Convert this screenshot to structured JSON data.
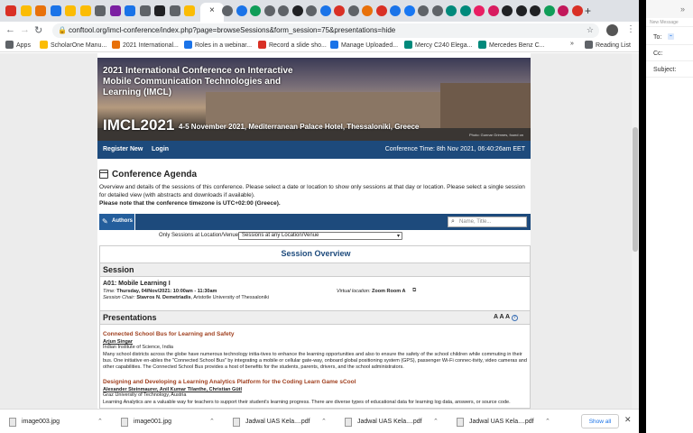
{
  "browser": {
    "url": "conftool.org/imcl-conference/index.php?page=browseSessions&form_session=75&presentations=hide",
    "tab_colors": [
      "#d93025",
      "#fbbc04",
      "#e8710a",
      "#1a73e8",
      "#fbbc04",
      "#fbbc04",
      "#5f6368",
      "#7b1fa2",
      "#1a73e8",
      "#5f6368",
      "#202124",
      "#5f6368",
      "#fbbc04"
    ],
    "tab_colors_right": [
      "#5f6368",
      "#1a73e8",
      "#0f9d58",
      "#5f6368",
      "#5f6368",
      "#202124",
      "#5f6368",
      "#1a73e8",
      "#d93025",
      "#5f6368",
      "#e8710a",
      "#d93025",
      "#1a73e8",
      "#1877f2",
      "#5f6368",
      "#5f6368",
      "#00897b",
      "#00897b",
      "#e91e63",
      "#d81b60",
      "#202124",
      "#202124",
      "#202124",
      "#0f9d58",
      "#c2185b",
      "#d93025"
    ]
  },
  "bookmarks": [
    {
      "label": "Apps",
      "color": "#5f6368"
    },
    {
      "label": "ScholarOne Manu...",
      "color": "#fbbc04"
    },
    {
      "label": "2021 International...",
      "color": "#e8710a"
    },
    {
      "label": "Roles in a webinar...",
      "color": "#1a73e8"
    },
    {
      "label": "Record a slide sho...",
      "color": "#d93025"
    },
    {
      "label": "Manage Uploaded...",
      "color": "#1a73e8"
    },
    {
      "label": "Mercy C240 Elega...",
      "color": "#00897b"
    },
    {
      "label": "Mercedes Benz C...",
      "color": "#00897b"
    },
    {
      "label": "»",
      "color": ""
    },
    {
      "label": "Reading List",
      "color": "#5f6368"
    }
  ],
  "banner": {
    "title": "2021 International Conference on Interactive Mobile Communication Technologies and Learning (IMCL)",
    "acronym": "IMCL2021",
    "date_venue": "4-5 November 2021, Mediterranean Palace Hotel, Thessaloniki, Greece",
    "credit": "Photo: Gunnar Grimnes, found on"
  },
  "nav": {
    "register": "Register New",
    "login": "Login",
    "time": "Conference Time: 8th Nov 2021, 06:40:26am EET"
  },
  "agenda": {
    "title": "Conference Agenda",
    "description": "Overview and details of the sessions of this conference. Please select a date or location to show only sessions at that day or location. Please select a single session for detailed view (with abstracts and downloads if available).",
    "timezone_note": "Please note that the conference timezone is UTC+02:00 (Greece).",
    "authors_tab": "Authors",
    "search_placeholder": "Name, Title...",
    "location_label": "Only Sessions at Location/Venue",
    "location_value": "Sessions at any Location/Venue"
  },
  "overview": {
    "title": "Session Overview",
    "session_head": "Session",
    "session_name": "A01: Mobile Learning I",
    "time_label": "Time:",
    "time_value": "Thursday, 04/Nov/2021: 10:00am - 11:30am",
    "chair_label": "Session Chair:",
    "chair_value": "Stavros N. Demetriadis",
    "chair_affil": ", Aristotle University of Thessaloniki",
    "location_label": "Virtual location:",
    "location_value": "Zoom Room A",
    "presentations_head": "Presentations",
    "font_controls": "A A A"
  },
  "papers": [
    {
      "title": "Connected School Bus for Learning and Safety",
      "authors": "Arjun Singar",
      "affiliation": "Indian Institute of Science, India",
      "abstract": "Many school districts across the globe have numerous technology initia-tives to enhance the learning opportunities and also to ensure the safety of the school children while commuting in their bus. One initiative en-ables the \"Connected School Bus\" by integrating a mobile or cellular gate-way, onboard global positioning system (GPS), passenger Wi-Fi connec-tivity, video cameras and other capabilities. The Connected School Bus provides a host of benefits for the students, parents, drivers, and the school administrators."
    },
    {
      "title": "Designing and Developing a Learning Analytics Platform for the Coding Learn Game sCool",
      "authors": "Alexander Steinmaurer, Anil Kumar Tilanthe, Christian Gütl",
      "affiliation": "Graz University of Technology, Austria",
      "abstract": "Learning Analytics are a valuable way for teachers to support their student's learning progress. There are diverse types of educational data for learning log data, answers, or source code."
    }
  ],
  "downloads": {
    "items": [
      "image003.jpg",
      "image001.jpg",
      "Jadwal UAS Kela....pdf",
      "Jadwal UAS Kela....pdf",
      "Jadwal UAS Kela....pdf"
    ],
    "show_all": "Show all"
  },
  "mail": {
    "header": "New Message",
    "to": "To:",
    "cc": "Cc:",
    "subject": "Subject:"
  }
}
